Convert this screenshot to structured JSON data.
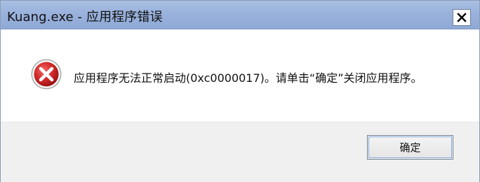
{
  "window": {
    "title": "Kuang.exe - 应用程序错误",
    "close_icon": "close-icon"
  },
  "dialog": {
    "icon": "error-icon",
    "message": "应用程序无法正常启动(0xc0000017)。请单击“确定”关闭应用程序。"
  },
  "buttons": {
    "ok_label": "确定"
  },
  "colors": {
    "titlebar": "#99b2dc",
    "footer": "#f0f0f0",
    "error_red": "#c8202a"
  }
}
